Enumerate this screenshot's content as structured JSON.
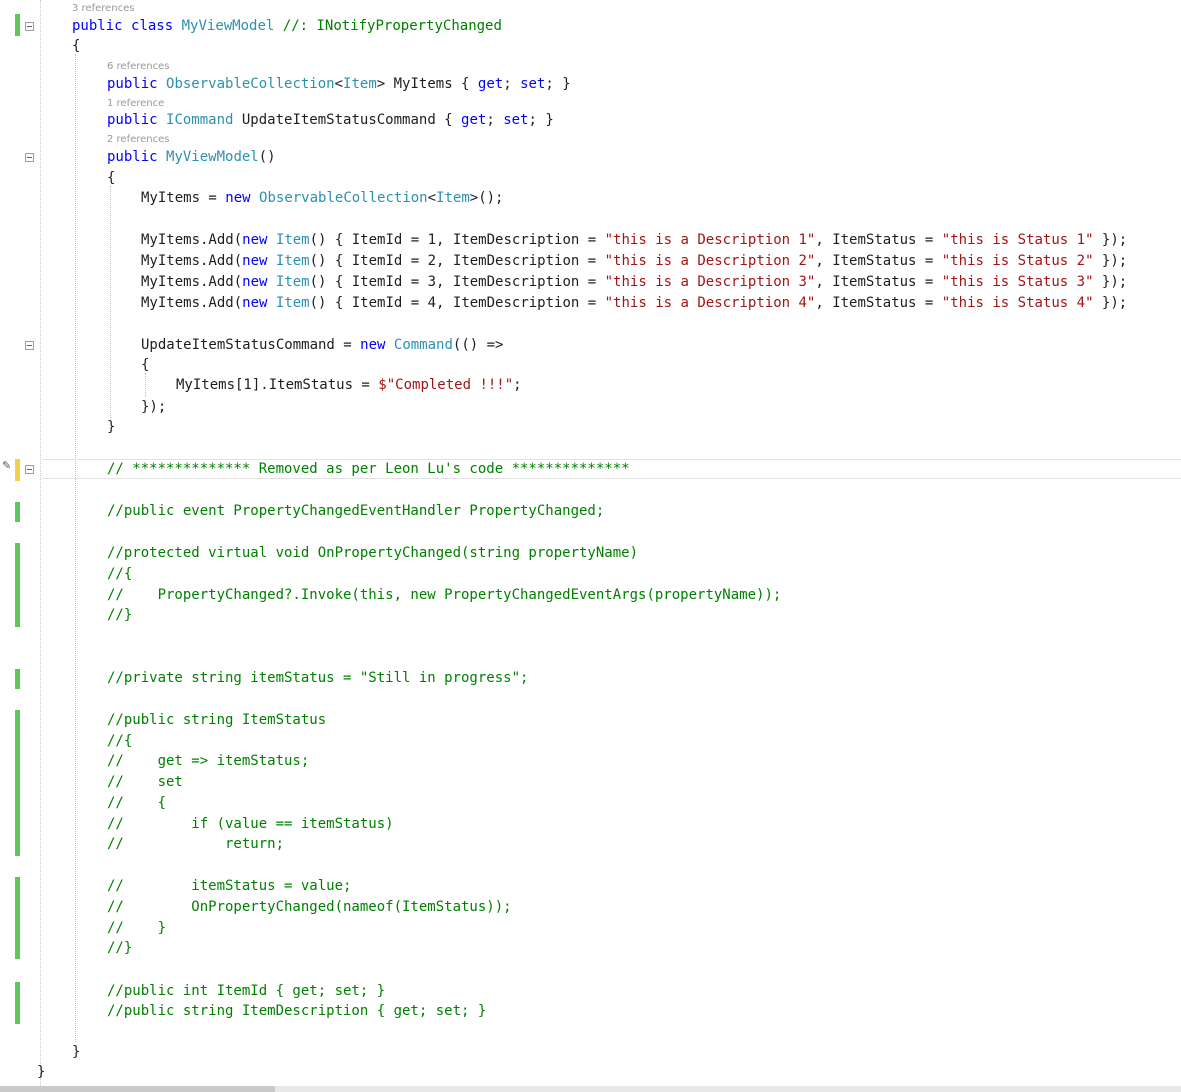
{
  "colors": {
    "keyword": "#0000ff",
    "type": "#2b91af",
    "string": "#a31515",
    "comment": "#008000",
    "plain": "#1e1e1e",
    "codelens": "#999999",
    "change_saved": "#5cc85c",
    "change_unsaved": "#f2d24a"
  },
  "codelens": {
    "class_refs": "3 references",
    "items_refs": "6 references",
    "command_refs": "1 reference",
    "ctor_refs": "2 references"
  },
  "code": {
    "class_public": "public",
    "class_kw": "class",
    "class_name": "MyViewModel",
    "class_comment": "//: INotifyPropertyChanged",
    "open_brace": "{",
    "close_brace": "}",
    "items_prop": {
      "public": "public",
      "type": "ObservableCollection",
      "generic_open": "<",
      "item_type": "Item",
      "generic_close": ">",
      "name": " MyItems { ",
      "get": "get",
      "semi1": "; ",
      "set": "set",
      "end": "; }"
    },
    "command_prop": {
      "public": "public",
      "type": "ICommand",
      "name": " UpdateItemStatusCommand { ",
      "get": "get",
      "semi1": "; ",
      "set": "set",
      "end": "; }"
    },
    "ctor": {
      "public": "public",
      "name": "MyViewModel",
      "parens": "()"
    },
    "init": {
      "lhs": "MyItems = ",
      "new": "new",
      "type": "ObservableCollection",
      "generic_open": "<",
      "item_type": "Item",
      "end": ">();"
    },
    "adds": [
      {
        "call": "MyItems.Add(",
        "new": "new",
        "type": "Item",
        "mid": "() { ItemId = 1, ItemDescription = ",
        "desc": "\"this is a Description 1\"",
        "mid2": ", ItemStatus = ",
        "status": "\"this is Status 1\"",
        "end": " });"
      },
      {
        "call": "MyItems.Add(",
        "new": "new",
        "type": "Item",
        "mid": "() { ItemId = 2, ItemDescription = ",
        "desc": "\"this is a Description 2\"",
        "mid2": ", ItemStatus = ",
        "status": "\"this is Status 2\"",
        "end": " });"
      },
      {
        "call": "MyItems.Add(",
        "new": "new",
        "type": "Item",
        "mid": "() { ItemId = 3, ItemDescription = ",
        "desc": "\"this is a Description 3\"",
        "mid2": ", ItemStatus = ",
        "status": "\"this is Status 3\"",
        "end": " });"
      },
      {
        "call": "MyItems.Add(",
        "new": "new",
        "type": "Item",
        "mid": "() { ItemId = 4, ItemDescription = ",
        "desc": "\"this is a Description 4\"",
        "mid2": ", ItemStatus = ",
        "status": "\"this is Status 4\"",
        "end": " });"
      }
    ],
    "cmd_assign": {
      "lhs": "UpdateItemStatusCommand = ",
      "new": "new",
      "type": "Command",
      "end": "(() =>"
    },
    "cmd_body": {
      "lhs": "MyItems[1].ItemStatus = ",
      "str": "$\"Completed !!!\"",
      "end": ";"
    },
    "cmd_close": "});",
    "comments": {
      "removed": "// ************** Removed as per Leon Lu's code **************",
      "event": "//public event PropertyChangedEventHandler PropertyChanged;",
      "onpc_sig": "//protected virtual void OnPropertyChanged(string propertyName)",
      "onpc_open": "//{",
      "onpc_body": "//    PropertyChanged?.Invoke(this, new PropertyChangedEventArgs(propertyName));",
      "onpc_close": "//}",
      "field": "//private string itemStatus = \"Still in progress\";",
      "prop_sig": "//public string ItemStatus",
      "prop_open": "//{",
      "prop_get": "//    get => itemStatus;",
      "prop_set": "//    set",
      "prop_set_open": "//    {",
      "prop_if": "//        if (value == itemStatus)",
      "prop_return": "//            return;",
      "prop_assign": "//        itemStatus = value;",
      "prop_notify": "//        OnPropertyChanged(nameof(ItemStatus));",
      "prop_set_close": "//    }",
      "prop_close": "//}",
      "itemid": "//public int ItemId { get; set; }",
      "itemdesc": "//public string ItemDescription { get; set; }"
    }
  }
}
